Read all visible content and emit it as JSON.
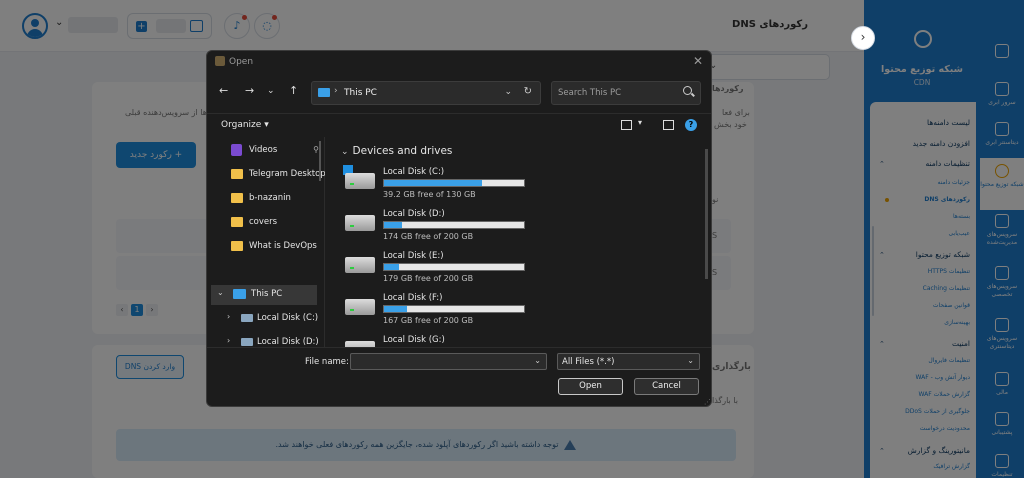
{
  "header": {
    "page_title": "رکوردهای DNS"
  },
  "content": {
    "add_record_label": "+ رکورد جدید",
    "import_dns_label": "وارد کردن DNS",
    "notice_text": "توجه داشته باشید اگر رکوردهای آپلود شده، جایگزین همه رکوردهای فعلی خواهند شد.",
    "pager": {
      "prev": "‹",
      "current": "1",
      "next": "›"
    },
    "peek_texts": [
      "رکوردها",
      "برای فعا",
      "ها از سرویس‌دهنده قبلی",
      "خود بخش",
      "نو",
      "S",
      "S",
      "بارگذاری",
      "با بارگذا"
    ]
  },
  "sidebar": {
    "brand_title": "شبکه توزیع محتوا",
    "brand_subtitle": "CDN",
    "rail": [
      {
        "label": "",
        "icon": "home-icon"
      },
      {
        "label": "سرور ابری",
        "icon": "cloud-server-icon"
      },
      {
        "label": "دیتاسنتر ابری",
        "icon": "datacenter-icon"
      },
      {
        "label": "شبکه توزیع محتوا",
        "icon": "cdn-icon"
      },
      {
        "label": "سرویس‌های مدیریت‌شده",
        "icon": "managed-services-icon"
      },
      {
        "label": "سرویس‌های تخصصی",
        "icon": "special-services-icon"
      },
      {
        "label": "سرویس‌های دیتاسنتری",
        "icon": "datacenter-services-icon"
      },
      {
        "label": "مالی",
        "icon": "finance-icon"
      },
      {
        "label": "پشتیبانی",
        "icon": "support-icon"
      },
      {
        "label": "تنظیمات",
        "icon": "settings-icon"
      }
    ],
    "menu": [
      {
        "text": "لیست دامنه‌ها",
        "kind": "hd"
      },
      {
        "text": "افزودن دامنه جدید",
        "kind": "hd"
      },
      {
        "text": "تنظیمات دامنه",
        "kind": "hd"
      },
      {
        "text": "جزئیات دامنه",
        "kind": "sub"
      },
      {
        "text": "رکوردهای DNS",
        "kind": "sub"
      },
      {
        "text": "بسته‌ها",
        "kind": "sub"
      },
      {
        "text": "عیب‌یابی",
        "kind": "sub"
      },
      {
        "text": "شبکه توزیع محتوا",
        "kind": "hd"
      },
      {
        "text": "تنظیمات HTTPS",
        "kind": "sub"
      },
      {
        "text": "تنظیمات Caching",
        "kind": "sub"
      },
      {
        "text": "قوانین صفحات",
        "kind": "sub"
      },
      {
        "text": "بهینه‌سازی",
        "kind": "sub"
      },
      {
        "text": "امنیت",
        "kind": "hd"
      },
      {
        "text": "تنظیمات فایروال",
        "kind": "sub"
      },
      {
        "text": "دیوار آتش وب - WAF",
        "kind": "sub"
      },
      {
        "text": "گزارش حملات WAF",
        "kind": "sub"
      },
      {
        "text": "جلوگیری از حملات DDoS",
        "kind": "sub"
      },
      {
        "text": "محدودیت درخواست",
        "kind": "sub"
      },
      {
        "text": "مانیتورینگ و گزارش",
        "kind": "hd"
      },
      {
        "text": "گزارش ترافیک",
        "kind": "sub"
      }
    ]
  },
  "dialog": {
    "title": "Open",
    "address": "This PC",
    "search_placeholder": "Search This PC",
    "organize_label": "Organize",
    "tree": [
      {
        "label": "Videos",
        "type": "video",
        "pinned": true
      },
      {
        "label": "Telegram Desktop",
        "type": "folder"
      },
      {
        "label": "b-nazanin",
        "type": "folder"
      },
      {
        "label": "covers",
        "type": "folder"
      },
      {
        "label": "What is DevOps",
        "type": "folder"
      },
      {
        "label": "This PC",
        "type": "pc",
        "selected": true
      },
      {
        "label": "Local Disk (C:)",
        "type": "disk"
      },
      {
        "label": "Local Disk (D:)",
        "type": "disk"
      }
    ],
    "section_title": "Devices and drives",
    "drives": [
      {
        "name": "Local Disk (C:)",
        "free": "39.2 GB free of 130 GB",
        "used_fraction": 0.7,
        "system": true
      },
      {
        "name": "Local Disk (D:)",
        "free": "174 GB free of 200 GB",
        "used_fraction": 0.13
      },
      {
        "name": "Local Disk (E:)",
        "free": "179 GB free of 200 GB",
        "used_fraction": 0.105
      },
      {
        "name": "Local Disk (F:)",
        "free": "167 GB free of 200 GB",
        "used_fraction": 0.165
      },
      {
        "name": "Local Disk (G:)",
        "free": "",
        "used_fraction": 0
      }
    ],
    "file_name_label": "File name:",
    "file_name_value": "",
    "file_type": "All Files (*.*)",
    "open_label": "Open",
    "cancel_label": "Cancel"
  },
  "colors": {
    "brand_blue": "#1f7fd1",
    "accent_orange": "#f0a500",
    "dialog_bg": "#1c1c1c",
    "drive_bar": "#3aa0e8"
  }
}
